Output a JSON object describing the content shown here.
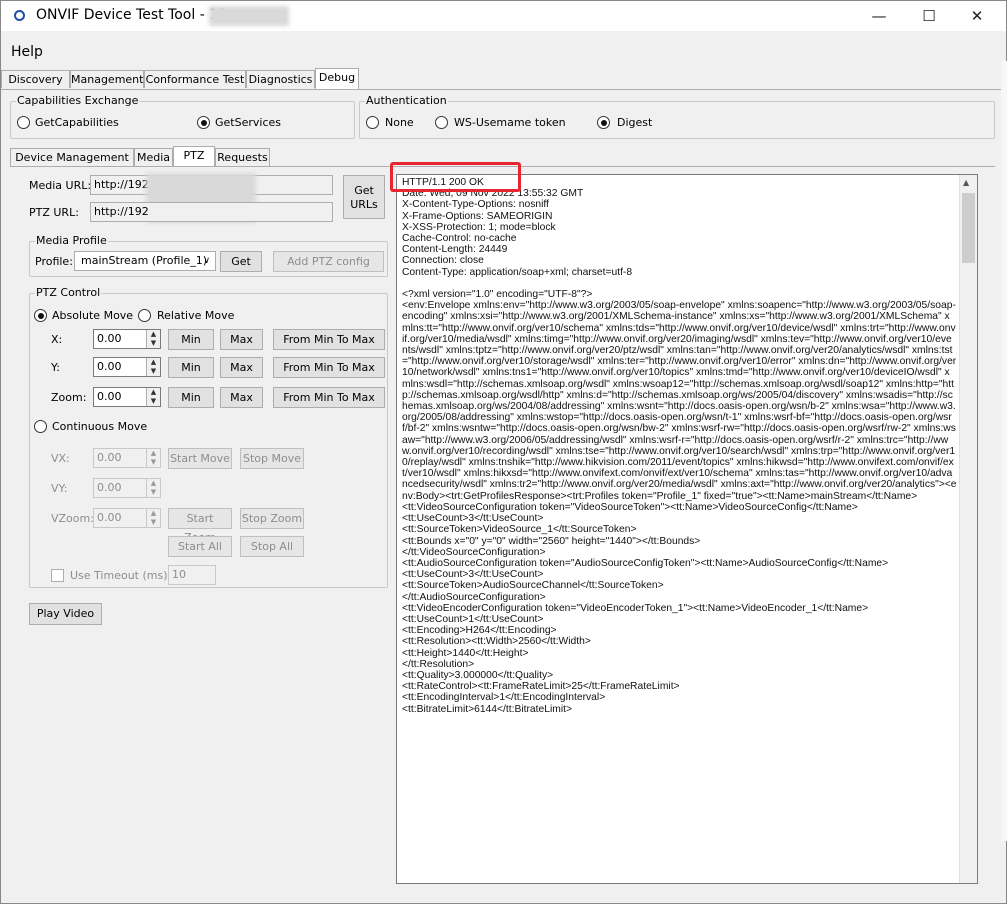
{
  "window": {
    "title": "ONVIF Device Test Tool - 19",
    "minimize": "—",
    "maximize": "☐",
    "close": "✕"
  },
  "menu": {
    "help": "Help"
  },
  "main_tabs": [
    "Discovery",
    "Management",
    "Conformance Test",
    "Diagnostics",
    "Debug"
  ],
  "capabilities": {
    "title": "Capabilities Exchange",
    "get_capabilities": "GetCapabilities",
    "get_services": "GetServices",
    "selected": "GetServices"
  },
  "authentication": {
    "title": "Authentication",
    "none": "None",
    "ws_username": "WS-Usemame token",
    "digest": "Digest",
    "selected": "Digest"
  },
  "sub_tabs": [
    "Device Management",
    "Media",
    "PTZ",
    "Requests"
  ],
  "urls": {
    "media_label": "Media URL:",
    "media_value": "http://192",
    "ptz_label": "PTZ URL:",
    "ptz_value": "http://192",
    "get_urls_line1": "Get",
    "get_urls_line2": "URLs"
  },
  "media_profile": {
    "title": "Media Profile",
    "profile_label": "Profile:",
    "profile_value": "mainStream (Profile_1)",
    "get": "Get",
    "add_ptz": "Add PTZ config"
  },
  "ptz_control": {
    "title": "PTZ Control",
    "absolute_move": "Absolute Move",
    "relative_move": "Relative Move",
    "x_label": "X:",
    "y_label": "Y:",
    "zoom_label": "Zoom:",
    "x_value": "0.00",
    "y_value": "0.00",
    "zoom_value": "0.00",
    "min": "Min",
    "max": "Max",
    "from_min_to_max": "From Min To Max",
    "continuous_move": "Continuous Move",
    "vx_label": "VX:",
    "vy_label": "VY:",
    "vzoom_label": "VZoom:",
    "vx_value": "0.00",
    "vy_value": "0.00",
    "vzoom_value": "0.00",
    "start_move": "Start Move",
    "stop_move": "Stop Move",
    "start_zoom": "Start Zoom",
    "stop_zoom": "Stop Zoom",
    "start_all": "Start All",
    "stop_all": "Stop All",
    "use_timeout": "Use Timeout (ms)",
    "timeout_value": "10"
  },
  "play_video": "Play Video",
  "response_text": "HTTP/1.1 200 OK\nDate: Wed, 09 Nov 2022 13:55:32 GMT\nX-Content-Type-Options: nosniff\nX-Frame-Options: SAMEORIGIN\nX-XSS-Protection: 1; mode=block\nCache-Control: no-cache\nContent-Length: 24449\nConnection: close\nContent-Type: application/soap+xml; charset=utf-8\n\n<?xml version=\"1.0\" encoding=\"UTF-8\"?>\n<env:Envelope xmlns:env=\"http://www.w3.org/2003/05/soap-envelope\" xmlns:soapenc=\"http://www.w3.org/2003/05/soap-encoding\" xmlns:xsi=\"http://www.w3.org/2001/XMLSchema-instance\" xmlns:xs=\"http://www.w3.org/2001/XMLSchema\" xmlns:tt=\"http://www.onvif.org/ver10/schema\" xmlns:tds=\"http://www.onvif.org/ver10/device/wsdl\" xmlns:trt=\"http://www.onvif.org/ver10/media/wsdl\" xmlns:timg=\"http://www.onvif.org/ver20/imaging/wsdl\" xmlns:tev=\"http://www.onvif.org/ver10/events/wsdl\" xmlns:tptz=\"http://www.onvif.org/ver20/ptz/wsdl\" xmlns:tan=\"http://www.onvif.org/ver20/analytics/wsdl\" xmlns:tst=\"http://www.onvif.org/ver10/storage/wsdl\" xmlns:ter=\"http://www.onvif.org/ver10/error\" xmlns:dn=\"http://www.onvif.org/ver10/network/wsdl\" xmlns:tns1=\"http://www.onvif.org/ver10/topics\" xmlns:tmd=\"http://www.onvif.org/ver10/deviceIO/wsdl\" xmlns:wsdl=\"http://schemas.xmlsoap.org/wsdl\" xmlns:wsoap12=\"http://schemas.xmlsoap.org/wsdl/soap12\" xmlns:http=\"http://schemas.xmlsoap.org/wsdl/http\" xmlns:d=\"http://schemas.xmlsoap.org/ws/2005/04/discovery\" xmlns:wsadis=\"http://schemas.xmlsoap.org/ws/2004/08/addressing\" xmlns:wsnt=\"http://docs.oasis-open.org/wsn/b-2\" xmlns:wsa=\"http://www.w3.org/2005/08/addressing\" xmlns:wstop=\"http://docs.oasis-open.org/wsn/t-1\" xmlns:wsrf-bf=\"http://docs.oasis-open.org/wsrf/bf-2\" xmlns:wsntw=\"http://docs.oasis-open.org/wsn/bw-2\" xmlns:wsrf-rw=\"http://docs.oasis-open.org/wsrf/rw-2\" xmlns:wsaw=\"http://www.w3.org/2006/05/addressing/wsdl\" xmlns:wsrf-r=\"http://docs.oasis-open.org/wsrf/r-2\" xmlns:trc=\"http://www.onvif.org/ver10/recording/wsdl\" xmlns:tse=\"http://www.onvif.org/ver10/search/wsdl\" xmlns:trp=\"http://www.onvif.org/ver10/replay/wsdl\" xmlns:tnshik=\"http://www.hikvision.com/2011/event/topics\" xmlns:hikwsd=\"http://www.onvifext.com/onvif/ext/ver10/wsdl\" xmlns:hikxsd=\"http://www.onvifext.com/onvif/ext/ver10/schema\" xmlns:tas=\"http://www.onvif.org/ver10/advancedsecurity/wsdl\" xmlns:tr2=\"http://www.onvif.org/ver20/media/wsdl\" xmlns:axt=\"http://www.onvif.org/ver20/analytics\"><env:Body><trt:GetProfilesResponse><trt:Profiles token=\"Profile_1\" fixed=\"true\"><tt:Name>mainStream</tt:Name>\n<tt:VideoSourceConfiguration token=\"VideoSourceToken\"><tt:Name>VideoSourceConfig</tt:Name>\n<tt:UseCount>3</tt:UseCount>\n<tt:SourceToken>VideoSource_1</tt:SourceToken>\n<tt:Bounds x=\"0\" y=\"0\" width=\"2560\" height=\"1440\"></tt:Bounds>\n</tt:VideoSourceConfiguration>\n<tt:AudioSourceConfiguration token=\"AudioSourceConfigToken\"><tt:Name>AudioSourceConfig</tt:Name>\n<tt:UseCount>3</tt:UseCount>\n<tt:SourceToken>AudioSourceChannel</tt:SourceToken>\n</tt:AudioSourceConfiguration>\n<tt:VideoEncoderConfiguration token=\"VideoEncoderToken_1\"><tt:Name>VideoEncoder_1</tt:Name>\n<tt:UseCount>1</tt:UseCount>\n<tt:Encoding>H264</tt:Encoding>\n<tt:Resolution><tt:Width>2560</tt:Width>\n<tt:Height>1440</tt:Height>\n</tt:Resolution>\n<tt:Quality>3.000000</tt:Quality>\n<tt:RateControl><tt:FrameRateLimit>25</tt:FrameRateLimit>\n<tt:EncodingInterval>1</tt:EncodingInterval>\n<tt:BitrateLimit>6144</tt:BitrateLimit>"
}
